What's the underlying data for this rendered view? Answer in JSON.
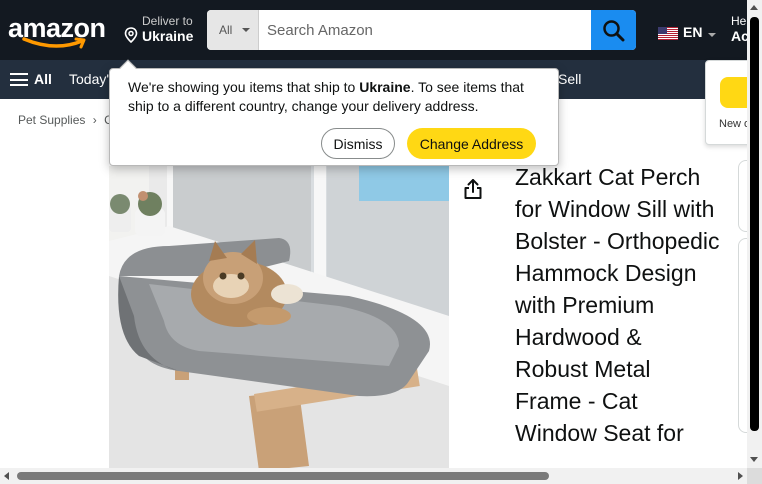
{
  "header": {
    "logo_text": "amazon",
    "deliver_line1": "Deliver to",
    "deliver_line2": "Ukraine",
    "search_category": "All",
    "search_placeholder": "Search Amazon",
    "language": "EN",
    "account_line1": "He",
    "account_line2": "Ac"
  },
  "nav": {
    "all_label": "All",
    "links": [
      "Today's",
      "Sell"
    ]
  },
  "breadcrumb": [
    "Pet Supplies",
    "›",
    "C"
  ],
  "popover": {
    "text_before": "We're showing you items that ship to ",
    "country": "Ukraine",
    "text_after": ". To see items that ship to a different country, change your delivery address.",
    "dismiss_label": "Dismiss",
    "change_label": "Change Address"
  },
  "product": {
    "title": "Zakkart Cat Perch for Window Sill with Bolster - Orthopedic Hammock Design with Premium Hardwood & Robust Metal Frame - Cat Window Seat for",
    "image_icon": "cat-perch-photo"
  },
  "buy_box": {
    "partial_text": "New o"
  },
  "icons": {
    "location": "map-pin-icon",
    "search": "search-icon",
    "flag": "us-flag-icon",
    "share": "share-icon",
    "menu": "hamburger-icon"
  },
  "colors": {
    "header_bg": "#131921",
    "nav_bg": "#232f3e",
    "search_btn": "#1a8cf0",
    "yellow_btn": "#ffd814",
    "logo_smile": "#ff9900"
  }
}
